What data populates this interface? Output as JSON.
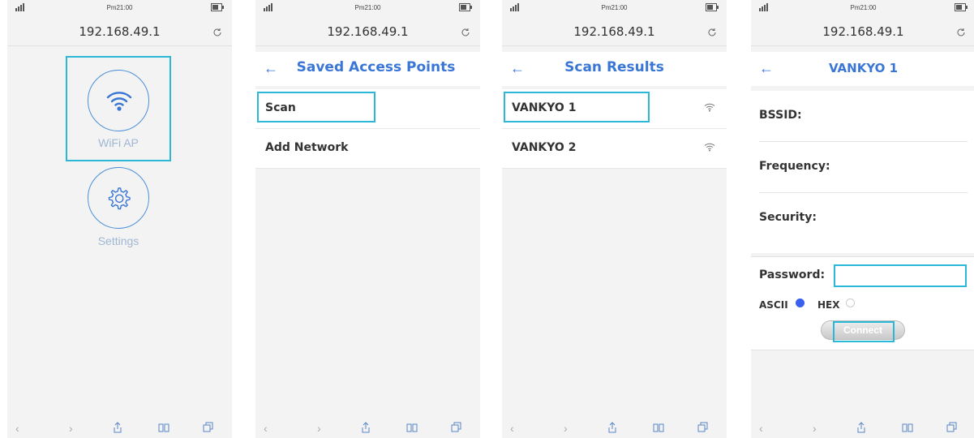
{
  "status_bar": {
    "time": "Pm21:00"
  },
  "browser": {
    "url": "192.168.49.1"
  },
  "screen1": {
    "wifi_label": "WiFi AP",
    "settings_label": "Settings"
  },
  "screen2": {
    "title": "Saved Access Points",
    "items": [
      {
        "label": "Scan"
      },
      {
        "label": "Add Network"
      }
    ]
  },
  "screen3": {
    "title": "Scan Results",
    "items": [
      {
        "label": "VANKYO 1"
      },
      {
        "label": "VANKYO 2"
      }
    ]
  },
  "screen4": {
    "title": "VANKYO 1",
    "bssid_label": "BSSID:",
    "frequency_label": "Frequency:",
    "security_label": "Security:",
    "password_label": "Password:",
    "password_value": "",
    "ascii_label": "ASCII",
    "hex_label": "HEX",
    "selected_encoding": "ASCII",
    "connect_label": "Connect"
  },
  "colors": {
    "accent": "#3a76d6",
    "highlight": "#2ab7d8",
    "muted_label": "#a0b7d3"
  }
}
